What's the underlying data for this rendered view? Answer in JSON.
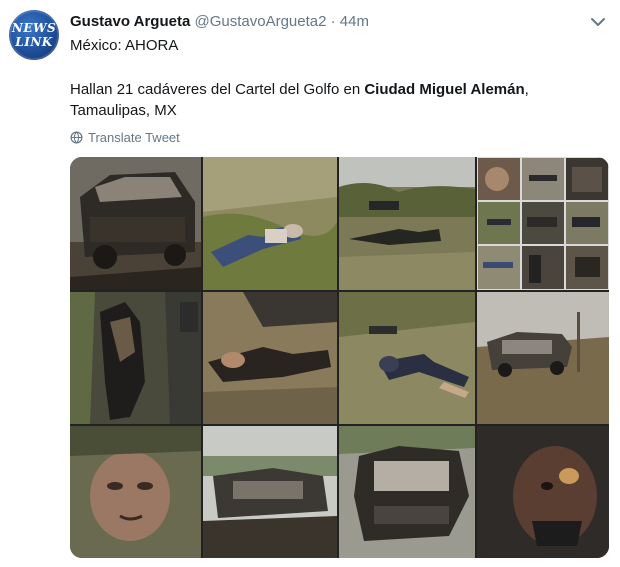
{
  "tweet": {
    "author_name": "Gustavo Argueta",
    "handle": "@GustavoArgueta2",
    "separator": "·",
    "time": "44m",
    "line1": "México: AHORA",
    "body_part1": "Hallan 21 cadáveres del Cartel del Golfo en ",
    "body_bold": "Ciudad Miguel Alemán",
    "body_part2": ", Tamaulipas, MX",
    "translate_label": "Translate Tweet"
  },
  "avatar": {
    "text_line1": "NEWS",
    "text_line2": "LINK"
  },
  "icons": {
    "menu": "chevron-down-icon",
    "translate": "globe-icon"
  },
  "colors": {
    "secondary_text": "#657786",
    "primary_text": "#14171a",
    "link_blue": "#1da1f2"
  },
  "media": {
    "photo_count": 15,
    "photos": [
      {
        "desc": "burned-pickup-truck"
      },
      {
        "desc": "body-on-grass"
      },
      {
        "desc": "bodies-in-brush"
      },
      {
        "desc": "collage-small-1"
      },
      {
        "desc": "collage-small-2"
      },
      {
        "desc": "collage-small-3"
      },
      {
        "desc": "burned-body-closeup"
      },
      {
        "desc": "bodies-near-wreck"
      },
      {
        "desc": "body-in-brush"
      },
      {
        "desc": "burned-truck-field"
      },
      {
        "desc": "face-closeup"
      },
      {
        "desc": "burned-trucks-dirt"
      },
      {
        "desc": "burned-pickup-front"
      },
      {
        "desc": "burned-face-closeup"
      }
    ]
  }
}
